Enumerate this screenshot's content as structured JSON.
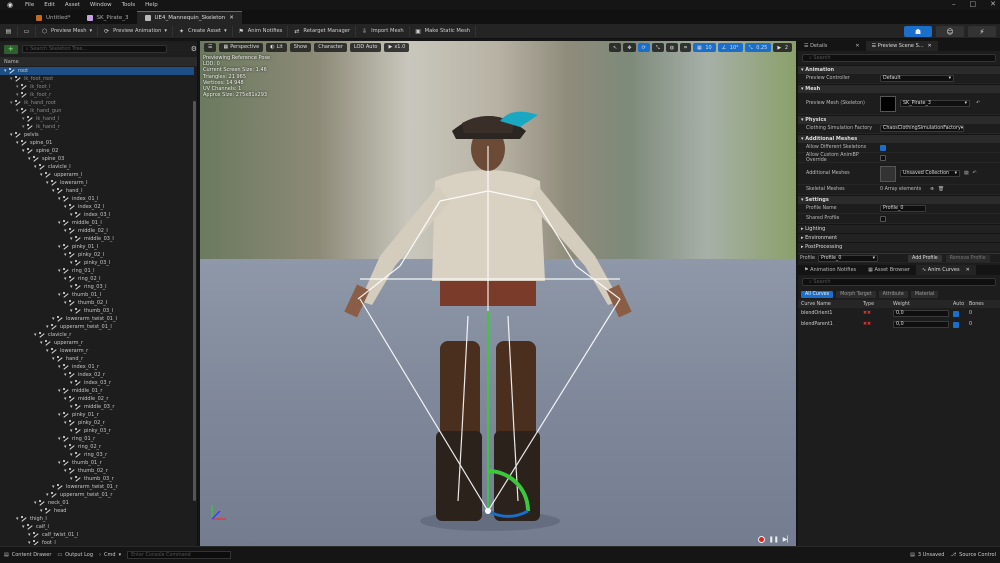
{
  "menu": {
    "items": [
      "File",
      "Edit",
      "Asset",
      "Window",
      "Tools",
      "Help"
    ]
  },
  "tabs": [
    {
      "label": "Untitled*",
      "active": false
    },
    {
      "label": "SK_Pirate_3",
      "active": false
    },
    {
      "label": "UE4_Mannequin_Skeleton",
      "active": true
    }
  ],
  "toolbar": {
    "items": [
      "Preview Mesh",
      "Preview Animation",
      "Create Asset",
      "Anim Notifies",
      "Retarget Manager",
      "Import Mesh",
      "Make Static Mesh"
    ]
  },
  "skeleton_tree": {
    "search_placeholder": "Search Skeleton Tree...",
    "column_name": "Name",
    "bones": [
      {
        "name": "root",
        "depth": 0,
        "selected": true
      },
      {
        "name": "ik_foot_root",
        "depth": 1,
        "ik": true
      },
      {
        "name": "ik_foot_l",
        "depth": 2,
        "ik": true
      },
      {
        "name": "ik_foot_r",
        "depth": 2,
        "ik": true
      },
      {
        "name": "ik_hand_root",
        "depth": 1,
        "ik": true
      },
      {
        "name": "ik_hand_gun",
        "depth": 2,
        "ik": true
      },
      {
        "name": "ik_hand_l",
        "depth": 3,
        "ik": true
      },
      {
        "name": "ik_hand_r",
        "depth": 3,
        "ik": true
      },
      {
        "name": "pelvis",
        "depth": 1
      },
      {
        "name": "spine_01",
        "depth": 2
      },
      {
        "name": "spine_02",
        "depth": 3
      },
      {
        "name": "spine_03",
        "depth": 4
      },
      {
        "name": "clavicle_l",
        "depth": 5
      },
      {
        "name": "upperarm_l",
        "depth": 6
      },
      {
        "name": "lowerarm_l",
        "depth": 7
      },
      {
        "name": "hand_l",
        "depth": 8
      },
      {
        "name": "index_01_l",
        "depth": 9
      },
      {
        "name": "index_02_l",
        "depth": 10
      },
      {
        "name": "index_03_l",
        "depth": 11
      },
      {
        "name": "middle_01_l",
        "depth": 9
      },
      {
        "name": "middle_02_l",
        "depth": 10
      },
      {
        "name": "middle_03_l",
        "depth": 11
      },
      {
        "name": "pinky_01_l",
        "depth": 9
      },
      {
        "name": "pinky_02_l",
        "depth": 10
      },
      {
        "name": "pinky_03_l",
        "depth": 11
      },
      {
        "name": "ring_01_l",
        "depth": 9
      },
      {
        "name": "ring_02_l",
        "depth": 10
      },
      {
        "name": "ring_03_l",
        "depth": 11
      },
      {
        "name": "thumb_01_l",
        "depth": 9
      },
      {
        "name": "thumb_02_l",
        "depth": 10
      },
      {
        "name": "thumb_03_l",
        "depth": 11
      },
      {
        "name": "lowerarm_twist_01_l",
        "depth": 8
      },
      {
        "name": "upperarm_twist_01_l",
        "depth": 7
      },
      {
        "name": "clavicle_r",
        "depth": 5
      },
      {
        "name": "upperarm_r",
        "depth": 6
      },
      {
        "name": "lowerarm_r",
        "depth": 7
      },
      {
        "name": "hand_r",
        "depth": 8
      },
      {
        "name": "index_01_r",
        "depth": 9
      },
      {
        "name": "index_02_r",
        "depth": 10
      },
      {
        "name": "index_03_r",
        "depth": 11
      },
      {
        "name": "middle_01_r",
        "depth": 9
      },
      {
        "name": "middle_02_r",
        "depth": 10
      },
      {
        "name": "middle_03_r",
        "depth": 11
      },
      {
        "name": "pinky_01_r",
        "depth": 9
      },
      {
        "name": "pinky_02_r",
        "depth": 10
      },
      {
        "name": "pinky_03_r",
        "depth": 11
      },
      {
        "name": "ring_01_r",
        "depth": 9
      },
      {
        "name": "ring_02_r",
        "depth": 10
      },
      {
        "name": "ring_03_r",
        "depth": 11
      },
      {
        "name": "thumb_01_r",
        "depth": 9
      },
      {
        "name": "thumb_02_r",
        "depth": 10
      },
      {
        "name": "thumb_03_r",
        "depth": 11
      },
      {
        "name": "lowerarm_twist_01_r",
        "depth": 8
      },
      {
        "name": "upperarm_twist_01_r",
        "depth": 7
      },
      {
        "name": "neck_01",
        "depth": 5
      },
      {
        "name": "head",
        "depth": 6
      },
      {
        "name": "thigh_l",
        "depth": 2
      },
      {
        "name": "calf_l",
        "depth": 3
      },
      {
        "name": "calf_twist_01_l",
        "depth": 4
      },
      {
        "name": "foot_l",
        "depth": 4
      }
    ]
  },
  "viewport": {
    "perspective": "Perspective",
    "lit": "Lit",
    "show": "Show",
    "character": "Character",
    "lod": "LOD Auto",
    "speed": "x1.0",
    "grid_snap": "10",
    "angle_snap": "10°",
    "scale_snap": "0.25",
    "camera_speed": "2",
    "info": [
      "Previewing Reference Pose",
      "LOD: 0",
      "Current Screen Size: 1.46",
      "Triangles: 21 965",
      "Vertices: 14 948",
      "UV Channels: 1",
      "Approx Size: 275x81x293"
    ]
  },
  "details": {
    "tab_details": "Details",
    "tab_preview": "Preview Scene S...",
    "search_placeholder": "Search",
    "sections": {
      "animation": "Animation",
      "mesh": "Mesh",
      "physics": "Physics",
      "additional_meshes": "Additional Meshes",
      "settings": "Settings",
      "lighting": "Lighting",
      "environment": "Environment",
      "postprocessing": "PostProcessing"
    },
    "preview_controller_label": "Preview Controller",
    "preview_controller_value": "Default",
    "preview_mesh_label": "Preview Mesh (Skeleton)",
    "preview_mesh_value": "SK_Pirate_3",
    "clothing_label": "Clothing Simulation Factory",
    "clothing_value": "ChaosClothingSimulationFactory",
    "allow_diff_label": "Allow Different Skeletons",
    "allow_custom_label": "Allow Custom AnimBP Override",
    "additional_meshes_label": "Additional Meshes",
    "additional_meshes_value": "Unsaved Collection",
    "skeletal_meshes_label": "Skeletal Meshes",
    "skeletal_meshes_value": "0 Array elements",
    "profile_name_label": "Profile Name",
    "profile_name_value": "Profile_0",
    "shared_profile_label": "Shared Profile",
    "profile_label": "Profile",
    "profile_value": "Profile_0",
    "add_profile": "Add Profile",
    "remove_profile": "Remove Profile"
  },
  "anim_panel": {
    "tabs": [
      "Animation Notifies",
      "Asset Browser",
      "Anim Curves"
    ],
    "search_placeholder": "Search",
    "filters": [
      "All Curves",
      "Morph Target",
      "Attribute",
      "Material"
    ],
    "columns": [
      "Curve Name",
      "Type",
      "Weight",
      "Auto",
      "Bones"
    ],
    "curves": [
      {
        "name": "blendOrient1",
        "weight": "0,0",
        "bones": "0"
      },
      {
        "name": "blendParent1",
        "weight": "0,0",
        "bones": "0"
      }
    ]
  },
  "statusbar": {
    "content_drawer": "Content Drawer",
    "output_log": "Output Log",
    "cmd": "Cmd",
    "cmd_placeholder": "Enter Console Command",
    "unsaved": "3 Unsaved",
    "source_control": "Source Control"
  },
  "colors": {
    "accent": "#1b6fc9",
    "selection": "#1d4e86"
  }
}
